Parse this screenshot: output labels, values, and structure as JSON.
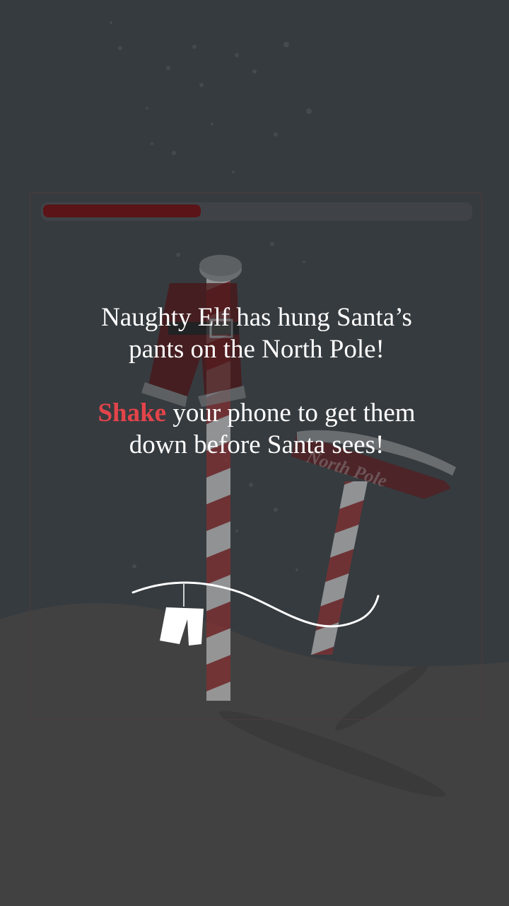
{
  "progress": {
    "value": 0.37,
    "fill_color": "#5b1417",
    "track_color": "#3f4347"
  },
  "scene": {
    "sky_color": "#363b3f",
    "snow_color": "#414141",
    "pole_stripe_colors": [
      "#9b2a2c",
      "#d9d9d9"
    ],
    "pants_color": "#6b1a1e",
    "sign_text": "North Pole"
  },
  "intro": {
    "line1": "Naughty Elf has hung Santa’s",
    "line2": "pants on the North Pole!",
    "shake_word": "Shake",
    "line3_rest": " your phone to get them",
    "line4": "down before Santa sees!",
    "accent_color": "#e2444a"
  },
  "gesture_hint": {
    "icon": "hanging-pants-icon",
    "color": "#ffffff"
  }
}
